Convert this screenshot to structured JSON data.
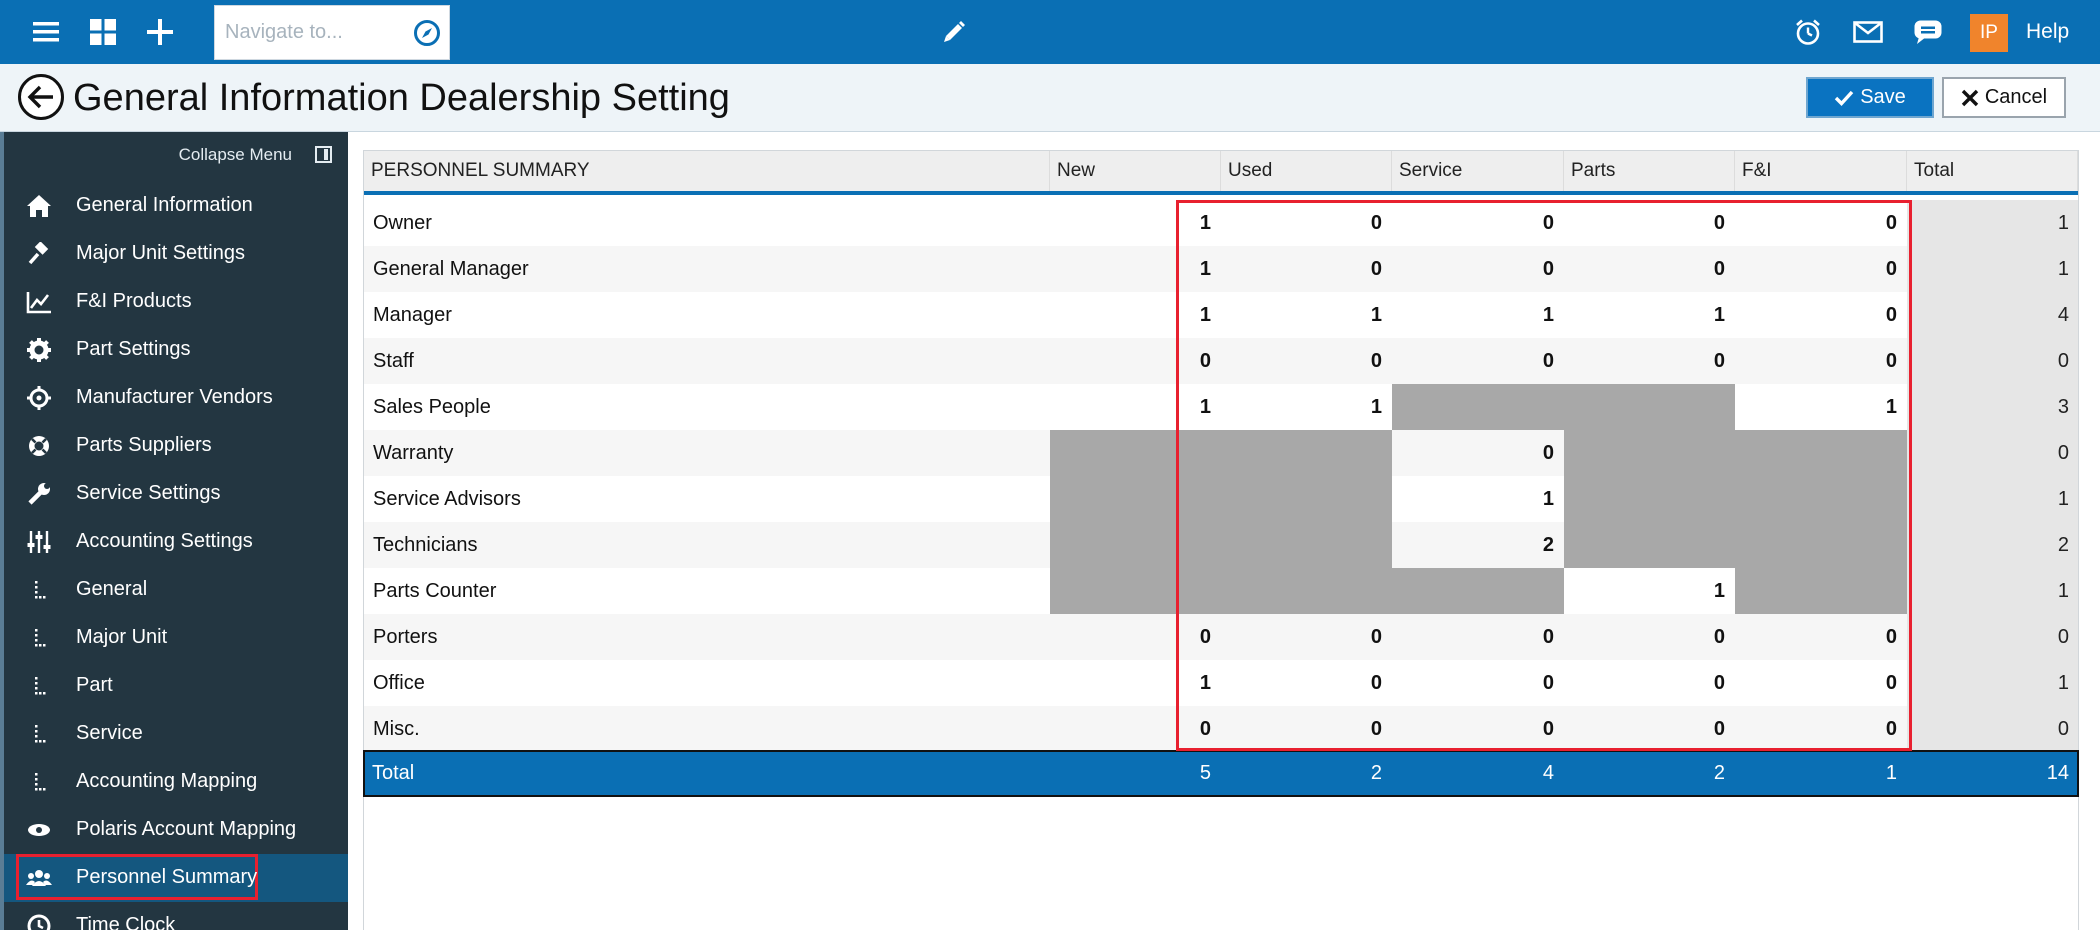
{
  "topbar": {
    "nav_placeholder": "Navigate to...",
    "avatar_initials": "IP",
    "help_label": "Help",
    "colors": {
      "bar": "#0a6fb4",
      "avatar": "#f0842c"
    },
    "icons": [
      "hamburger-menu-icon",
      "dashboard-grid-icon",
      "plus-icon",
      "compass-icon",
      "pencil-icon",
      "alarm-clock-icon",
      "mail-icon",
      "chat-icon"
    ]
  },
  "header": {
    "title": "General Information Dealership Setting",
    "save_label": "Save",
    "cancel_label": "Cancel"
  },
  "sidebar": {
    "collapse_label": "Collapse Menu",
    "items": [
      {
        "label": "General Information",
        "icon": "home-icon"
      },
      {
        "label": "Major Unit Settings",
        "icon": "gavel-icon"
      },
      {
        "label": "F&I Products",
        "icon": "line-chart-icon"
      },
      {
        "label": "Part Settings",
        "icon": "gear-icon"
      },
      {
        "label": "Manufacturer Vendors",
        "icon": "crosshair-icon"
      },
      {
        "label": "Parts Suppliers",
        "icon": "lifebuoy-icon"
      },
      {
        "label": "Service Settings",
        "icon": "wrench-icon"
      },
      {
        "label": "Accounting Settings",
        "icon": "sliders-icon"
      },
      {
        "label": "General",
        "icon": "sub-tree-icon"
      },
      {
        "label": "Major Unit",
        "icon": "sub-tree-icon"
      },
      {
        "label": "Part",
        "icon": "sub-tree-icon"
      },
      {
        "label": "Service",
        "icon": "sub-tree-icon"
      },
      {
        "label": "Accounting Mapping",
        "icon": "sub-tree-icon"
      },
      {
        "label": "Polaris Account Mapping",
        "icon": "eye-icon"
      },
      {
        "label": "Personnel Summary",
        "icon": "users-icon",
        "active": true
      },
      {
        "label": "Time Clock",
        "icon": "clock-icon"
      }
    ]
  },
  "table": {
    "headers": [
      "PERSONNEL SUMMARY",
      "New",
      "Used",
      "Service",
      "Parts",
      "F&I",
      "Total"
    ],
    "rows": [
      {
        "name": "Owner",
        "values": [
          "1",
          "0",
          "0",
          "0",
          "0"
        ],
        "total": "1"
      },
      {
        "name": "General Manager",
        "values": [
          "1",
          "0",
          "0",
          "0",
          "0"
        ],
        "total": "1"
      },
      {
        "name": "Manager",
        "values": [
          "1",
          "1",
          "1",
          "1",
          "0"
        ],
        "total": "4"
      },
      {
        "name": "Staff",
        "values": [
          "0",
          "0",
          "0",
          "0",
          "0"
        ],
        "total": "0"
      },
      {
        "name": "Sales People",
        "values": [
          "1",
          "1",
          null,
          null,
          "1"
        ],
        "total": "3"
      },
      {
        "name": "Warranty",
        "values": [
          null,
          null,
          "0",
          null,
          null
        ],
        "total": "0"
      },
      {
        "name": "Service Advisors",
        "values": [
          null,
          null,
          "1",
          null,
          null
        ],
        "total": "1"
      },
      {
        "name": "Technicians",
        "values": [
          null,
          null,
          "2",
          null,
          null
        ],
        "total": "2"
      },
      {
        "name": "Parts Counter",
        "values": [
          null,
          null,
          null,
          "1",
          null
        ],
        "total": "1"
      },
      {
        "name": "Porters",
        "values": [
          "0",
          "0",
          "0",
          "0",
          "0"
        ],
        "total": "0"
      },
      {
        "name": "Office",
        "values": [
          "1",
          "0",
          "0",
          "0",
          "0"
        ],
        "total": "1"
      },
      {
        "name": "Misc.",
        "values": [
          "0",
          "0",
          "0",
          "0",
          "0"
        ],
        "total": "0"
      }
    ],
    "totals": {
      "label": "Total",
      "values": [
        "5",
        "2",
        "4",
        "2",
        "1"
      ],
      "grand": "14"
    },
    "colors": {
      "header_rule": "#0a6fb4",
      "disabled_cell": "#a8a8a8",
      "highlight": "#e8202f"
    }
  }
}
